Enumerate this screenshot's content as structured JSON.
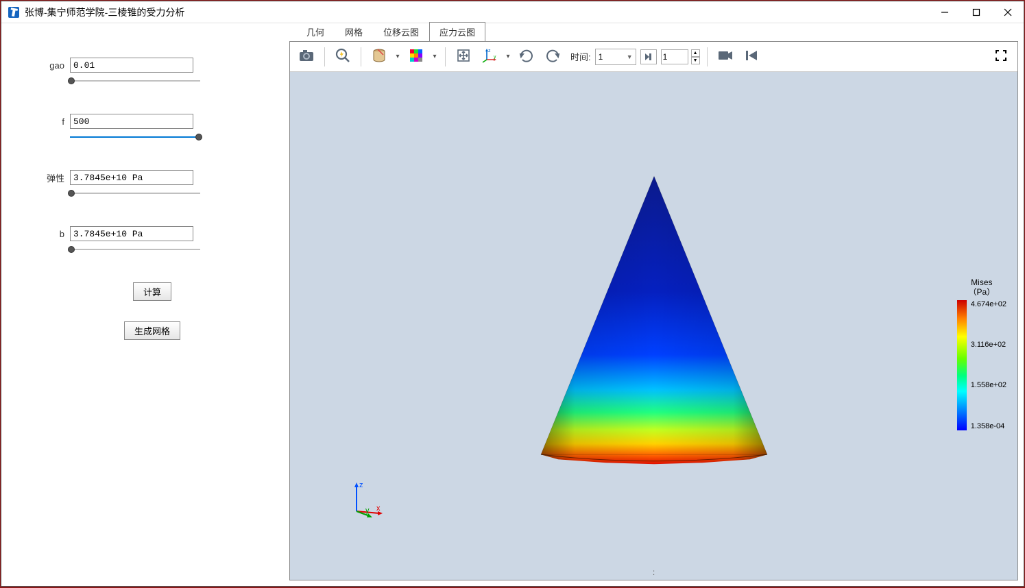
{
  "window_title": "张博-集宁师范学院-三棱锥的受力分析",
  "sidebar": {
    "params": [
      {
        "label": "gao",
        "value": "0.01"
      },
      {
        "label": "f",
        "value": "500"
      },
      {
        "label": "弹性",
        "value": "3.7845e+10 Pa"
      },
      {
        "label": "b",
        "value": "3.7845e+10 Pa"
      }
    ],
    "compute_button": "计算",
    "mesh_button": "生成网格"
  },
  "tabs": [
    "几何",
    "网格",
    "位移云图",
    "应力云图"
  ],
  "active_tab_index": 3,
  "toolbar": {
    "time_label": "时间:",
    "time_select": "1",
    "frame_value": "1"
  },
  "legend": {
    "title_line1": "Mises",
    "title_line2": "（Pa）",
    "stops": [
      "4.674e+02",
      "3.116e+02",
      "1.558e+02",
      "1.358e-04"
    ]
  },
  "axis": {
    "x": "x",
    "y": "y",
    "z": "z"
  },
  "status": ":"
}
